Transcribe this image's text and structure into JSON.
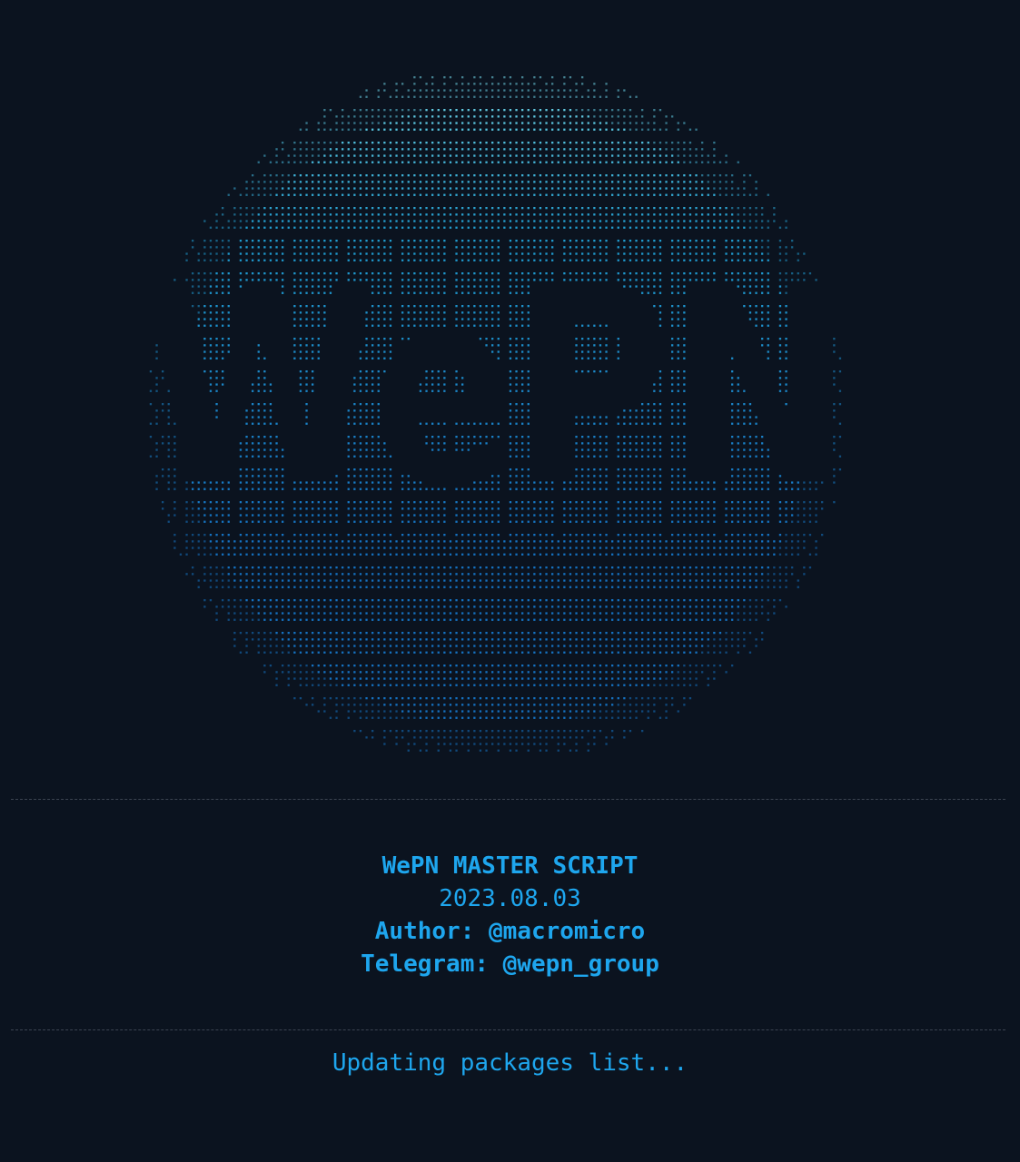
{
  "terminal": {
    "logo": {
      "name": "wepn-ascii-dot-logo",
      "text": "WePN",
      "colors": {
        "bright": "#7fe3f0",
        "mid": "#23a4d8",
        "deep": "#1676c9"
      }
    },
    "banner": {
      "title": "WePN MASTER SCRIPT",
      "date": "2023.08.03",
      "author": "Author: @macromicro",
      "telegram": "Telegram: @wepn_group"
    },
    "status": "Updating packages list...",
    "colors": {
      "background": "#0b131f",
      "text": "#1ea6ee",
      "rule": "#3c4452"
    }
  }
}
